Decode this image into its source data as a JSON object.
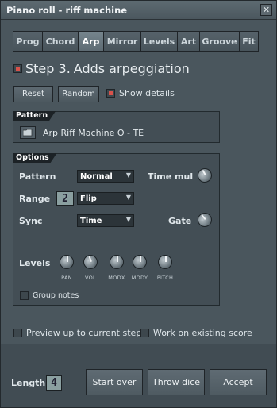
{
  "window": {
    "title": "Piano roll - riff machine",
    "close_glyph": "✕"
  },
  "tabs": [
    {
      "label": "Prog",
      "active": false
    },
    {
      "label": "Chord",
      "active": false
    },
    {
      "label": "Arp",
      "active": true
    },
    {
      "label": "Mirror",
      "active": false
    },
    {
      "label": "Levels",
      "active": false
    },
    {
      "label": "Art",
      "active": false
    },
    {
      "label": "Groove",
      "active": false
    },
    {
      "label": "Fit",
      "active": false
    }
  ],
  "step": {
    "prefix": "Step 3.",
    "title": "Adds arpeggiation",
    "checked": true
  },
  "actions": {
    "reset_label": "Reset",
    "random_label": "Random",
    "show_details_label": "Show details",
    "show_details_checked": true
  },
  "pattern_group": {
    "title": "Pattern",
    "name": "Arp Riff Machine O - TE"
  },
  "options": {
    "title": "Options",
    "pattern_label": "Pattern",
    "pattern_value": "Normal",
    "time_mul_label": "Time mul",
    "range_label": "Range",
    "range_number": "2",
    "range_value": "Flip",
    "sync_label": "Sync",
    "sync_value": "Time",
    "gate_label": "Gate",
    "levels_label": "Levels",
    "knobs": [
      "PAN",
      "VOL",
      "MODX",
      "MODY",
      "PITCH"
    ],
    "group_notes_label": "Group notes"
  },
  "footer_options": {
    "preview_label": "Preview up to current step",
    "work_existing_label": "Work on existing score"
  },
  "bottom": {
    "length_label": "Length",
    "length_value": "4",
    "start_over_label": "Start over",
    "throw_dice_label": "Throw dice",
    "accept_label": "Accept"
  },
  "colors": {
    "accent_red": "#d8524b",
    "panel": "#4a565d"
  }
}
